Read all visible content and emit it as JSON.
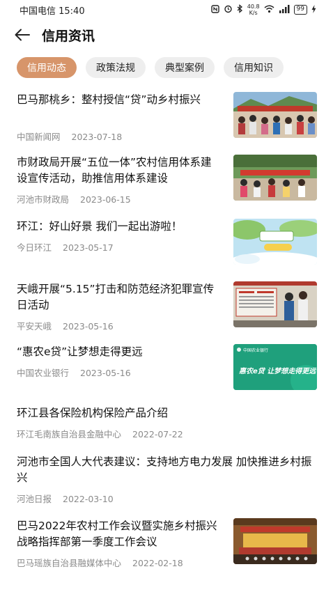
{
  "status": {
    "carrier_time": "中国电信 15:40",
    "speed_value": "40.8",
    "speed_unit": "K/s",
    "network": "4G",
    "battery": "99"
  },
  "header": {
    "title": "信用资讯"
  },
  "tabs": [
    {
      "label": "信用动态",
      "active": true
    },
    {
      "label": "政策法规",
      "active": false
    },
    {
      "label": "典型案例",
      "active": false
    },
    {
      "label": "信用知识",
      "active": false
    }
  ],
  "articles": [
    {
      "title": "巴马那桃乡：整村授信“贷”动乡村振兴",
      "source": "中国新闻网",
      "date": "2023-07-18",
      "thumb": "crowd-ceremony-photo"
    },
    {
      "title": "市财政局开展“五位一体”农村信用体系建设宣传活动，助推信用体系建设",
      "source": "河池市财政局",
      "date": "2023-06-15",
      "thumb": "outdoor-event-photo"
    },
    {
      "title": "环江：好山好景 我们一起出游啦！",
      "source": "今日环江",
      "date": "2023-05-17",
      "thumb": "scenic-promo-poster"
    },
    {
      "title": "天峨开展“5.15”打击和防范经济犯罪宣传日活动",
      "source": "平安天峨",
      "date": "2023-05-16",
      "thumb": "publicity-board-photo"
    },
    {
      "title": "“惠农e贷”让梦想走得更远",
      "source": "中国农业银行",
      "date": "2023-05-16",
      "thumb": "bank-promo-banner",
      "thumb_text": "惠农e贷 让梦想走得更远",
      "thumb_brand": "中国农业银行"
    },
    {
      "title": "环江县各保险机构保险产品介绍",
      "source": "环江毛南族自治县金融中心",
      "date": "2022-07-22"
    },
    {
      "title": "河池市全国人大代表建议：支持地方电力发展 加快推进乡村振兴",
      "source": "河池日报",
      "date": "2022-03-10"
    },
    {
      "title": "巴马2022年农村工作会议暨实施乡村振兴战略指挥部第一季度工作会议",
      "source": "巴马瑶族自治县融媒体中心",
      "date": "2022-02-18",
      "thumb": "conference-hall-photo"
    }
  ]
}
